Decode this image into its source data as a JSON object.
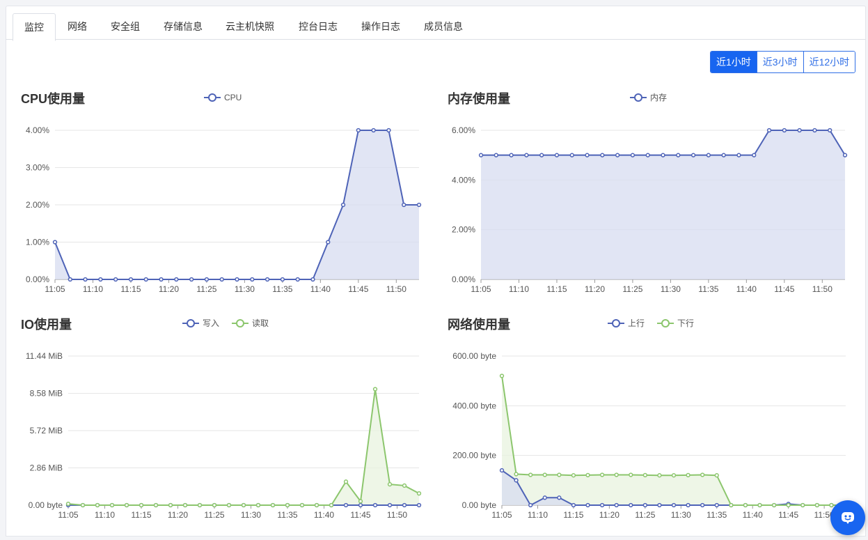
{
  "tabs": [
    {
      "label": "监控",
      "active": true
    },
    {
      "label": "网络"
    },
    {
      "label": "安全组"
    },
    {
      "label": "存储信息"
    },
    {
      "label": "云主机快照"
    },
    {
      "label": "控台日志"
    },
    {
      "label": "操作日志"
    },
    {
      "label": "成员信息"
    }
  ],
  "time_range": {
    "options": [
      "近1小时",
      "近3小时",
      "近12小时"
    ],
    "selected": "近1小时"
  },
  "colors": {
    "blue": "#4e63b7",
    "green": "#8cc66d",
    "blue_fill": "#d7dcf0",
    "green_fill": "#e8f3df"
  },
  "help_button": {
    "icon": "chat-robot-icon"
  },
  "chart_data": [
    {
      "id": "cpu",
      "type": "area",
      "title": "CPU使用量",
      "x_ticks": [
        "11:05",
        "11:10",
        "11:15",
        "11:20",
        "11:25",
        "11:30",
        "11:35",
        "11:40",
        "11:45",
        "11:50"
      ],
      "x_range_minutes": [
        0,
        48
      ],
      "ylim": [
        0,
        4
      ],
      "y_ticks": [
        0,
        1,
        2,
        3,
        4
      ],
      "y_tick_labels": [
        "0.00%",
        "1.00%",
        "2.00%",
        "3.00%",
        "4.00%"
      ],
      "series": [
        {
          "name": "CPU",
          "color": "#4e63b7",
          "x": [
            0,
            2,
            4,
            6,
            8,
            10,
            12,
            14,
            16,
            18,
            20,
            22,
            24,
            26,
            28,
            30,
            32,
            34,
            36,
            38,
            40,
            42,
            44,
            46,
            48
          ],
          "values": [
            1,
            0,
            0,
            0,
            0,
            0,
            0,
            0,
            0,
            0,
            0,
            0,
            0,
            0,
            0,
            0,
            0,
            0,
            1,
            2,
            4,
            4,
            4,
            2,
            2
          ]
        }
      ]
    },
    {
      "id": "mem",
      "type": "area",
      "title": "内存使用量",
      "x_ticks": [
        "11:05",
        "11:10",
        "11:15",
        "11:20",
        "11:25",
        "11:30",
        "11:35",
        "11:40",
        "11:45",
        "11:50"
      ],
      "x_range_minutes": [
        0,
        48
      ],
      "ylim": [
        0,
        6
      ],
      "y_ticks": [
        0,
        2,
        4,
        6
      ],
      "y_tick_labels": [
        "0.00%",
        "2.00%",
        "4.00%",
        "6.00%"
      ],
      "series": [
        {
          "name": "内存",
          "color": "#4e63b7",
          "x": [
            0,
            2,
            4,
            6,
            8,
            10,
            12,
            14,
            16,
            18,
            20,
            22,
            24,
            26,
            28,
            30,
            32,
            34,
            36,
            38,
            40,
            42,
            44,
            46,
            48
          ],
          "values": [
            5,
            5,
            5,
            5,
            5,
            5,
            5,
            5,
            5,
            5,
            5,
            5,
            5,
            5,
            5,
            5,
            5,
            5,
            5,
            6,
            6,
            6,
            6,
            6,
            5
          ]
        }
      ]
    },
    {
      "id": "io",
      "type": "area",
      "title": "IO使用量",
      "x_ticks": [
        "11:05",
        "11:10",
        "11:15",
        "11:20",
        "11:25",
        "11:30",
        "11:35",
        "11:40",
        "11:45",
        "11:50"
      ],
      "x_range_minutes": [
        0,
        48
      ],
      "ylim": [
        0,
        11.44
      ],
      "y_ticks": [
        0,
        2.86,
        5.72,
        8.58,
        11.44
      ],
      "y_tick_labels": [
        "0.00 byte",
        "2.86 MiB",
        "5.72 MiB",
        "8.58 MiB",
        "11.44 MiB"
      ],
      "series": [
        {
          "name": "写入",
          "color": "#4e63b7",
          "x": [
            0,
            2,
            4,
            6,
            8,
            10,
            12,
            14,
            16,
            18,
            20,
            22,
            24,
            26,
            28,
            30,
            32,
            34,
            36,
            38,
            40,
            42,
            44,
            46,
            48
          ],
          "values": [
            0,
            0,
            0,
            0,
            0,
            0,
            0,
            0,
            0,
            0,
            0,
            0,
            0,
            0,
            0,
            0,
            0,
            0,
            0,
            0,
            0,
            0,
            0,
            0,
            0
          ]
        },
        {
          "name": "读取",
          "color": "#8cc66d",
          "x": [
            0,
            2,
            4,
            6,
            8,
            10,
            12,
            14,
            16,
            18,
            20,
            22,
            24,
            26,
            28,
            30,
            32,
            34,
            36,
            38,
            40,
            42,
            44,
            46,
            48
          ],
          "values": [
            0.1,
            0,
            0,
            0,
            0,
            0,
            0,
            0,
            0,
            0,
            0,
            0,
            0,
            0,
            0,
            0,
            0,
            0,
            0,
            1.8,
            0.3,
            8.9,
            1.6,
            1.5,
            0.9
          ]
        }
      ]
    },
    {
      "id": "net",
      "type": "area",
      "title": "网络使用量",
      "x_ticks": [
        "11:05",
        "11:10",
        "11:15",
        "11:20",
        "11:25",
        "11:30",
        "11:35",
        "11:40",
        "11:45",
        "11:50"
      ],
      "x_range_minutes": [
        0,
        48
      ],
      "ylim": [
        0,
        600
      ],
      "y_ticks": [
        0,
        200,
        400,
        600
      ],
      "y_tick_labels": [
        "0.00 byte",
        "200.00 byte",
        "400.00 byte",
        "600.00 byte"
      ],
      "series": [
        {
          "name": "上行",
          "color": "#4e63b7",
          "x": [
            0,
            2,
            4,
            6,
            8,
            10,
            12,
            14,
            16,
            18,
            20,
            22,
            24,
            26,
            28,
            30,
            32,
            34,
            36,
            38,
            40,
            42,
            44,
            46,
            48
          ],
          "values": [
            140,
            100,
            0,
            30,
            30,
            0,
            0,
            0,
            0,
            0,
            0,
            0,
            0,
            0,
            0,
            0,
            0,
            0,
            0,
            0,
            5,
            0,
            0,
            0,
            0
          ]
        },
        {
          "name": "下行",
          "color": "#8cc66d",
          "x": [
            0,
            2,
            4,
            6,
            8,
            10,
            12,
            14,
            16,
            18,
            20,
            22,
            24,
            26,
            28,
            30,
            32,
            34,
            36,
            38,
            40,
            42,
            44,
            46,
            48
          ],
          "values": [
            520,
            125,
            122,
            122,
            122,
            120,
            121,
            122,
            122,
            122,
            121,
            120,
            120,
            121,
            122,
            120,
            0,
            0,
            0,
            0,
            0,
            0,
            0,
            0,
            0
          ]
        }
      ]
    }
  ]
}
